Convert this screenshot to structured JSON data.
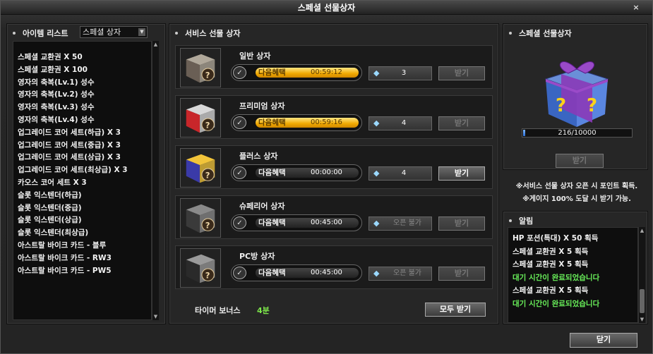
{
  "window": {
    "title": "스페셜 선물상자",
    "close_glyph": "×"
  },
  "item_list": {
    "header": "아이템 리스트",
    "dropdown_value": "스페셜 상자",
    "items": [
      "스페셜 교환권 X 50",
      "스페셜 교환권 X 100",
      "영자의 축복(Lv.1) 성수",
      "영자의 축복(Lv.2) 성수",
      "영자의 축복(Lv.3) 성수",
      "영자의 축복(Lv.4) 성수",
      "업그레이드 코어 세트(하급) X 3",
      "업그레이드 코어 세트(중급) X 3",
      "업그레이드 코어 세트(상급) X 3",
      "업그레이드 코어 세트(최상급) X 3",
      "카오스 코어 세트 X 3",
      "슬롯 익스텐더(하급)",
      "슬롯 익스텐더(중급)",
      "슬롯 익스텐더(상급)",
      "슬롯 익스텐더(최상급)",
      "아스트랄 바이크 카드 - 블루",
      "아스트랄 바이크 카드 - RW3",
      "아스트랄 바이크 카드 - PW5"
    ]
  },
  "service_boxes": {
    "header": "서비스 선물 상자",
    "boxes": [
      {
        "name": "일반 상자",
        "timer_label": "다음혜택",
        "time": "00:59:12",
        "progress": 1.0,
        "points": "3",
        "claim_label": "받기",
        "claim_enabled": false,
        "colors": [
          "#b0a89a",
          "#6a5f55"
        ]
      },
      {
        "name": "프리미엄 상자",
        "timer_label": "다음혜택",
        "time": "00:59:16",
        "progress": 1.0,
        "points": "4",
        "claim_label": "받기",
        "claim_enabled": false,
        "colors": [
          "#d8d8d8",
          "#c8262a"
        ]
      },
      {
        "name": "플러스 상자",
        "timer_label": "다음혜택",
        "time": "00:00:00",
        "progress": 0.0,
        "points": "4",
        "claim_label": "받기",
        "claim_enabled": true,
        "colors": [
          "#f2c43a",
          "#3a3aa8"
        ]
      },
      {
        "name": "슈페리어 상자",
        "timer_label": "다음혜택",
        "time": "00:45:00",
        "progress": 0.0,
        "points": "오픈 불가",
        "claim_label": "받기",
        "claim_enabled": false,
        "colors": [
          "#8a8a8a",
          "#3a3a3a"
        ]
      },
      {
        "name": "PC방 상자",
        "timer_label": "다음혜택",
        "time": "00:45:00",
        "progress": 0.0,
        "points": "오픈 불가",
        "claim_label": "받기",
        "claim_enabled": false,
        "colors": [
          "#9a9a9a",
          "#2a2a2a"
        ]
      }
    ],
    "timer_bonus_label": "타이머 보너스",
    "timer_bonus_value": "4분",
    "claim_all_label": "모두 받기"
  },
  "special_gift": {
    "header": "스페셜 선물상자",
    "gauge_text": "216/10000",
    "gauge_fraction": 0.0216,
    "claim_label": "받기",
    "notice_line1": "※서비스 선물 상자 오픈 시 포인트 획득.",
    "notice_line2": "※게이지 100% 도달 시 받기 가능."
  },
  "log": {
    "header": "알림",
    "lines": [
      {
        "text": "HP 포션(특대) X 50 획득",
        "green": false
      },
      {
        "text": "스페셜 교환권 X 5 획득",
        "green": false
      },
      {
        "text": "스페셜 교환권 X 5 획득",
        "green": false
      },
      {
        "text": "대기 시간이 완료되었습니다",
        "green": true
      },
      {
        "text": "스페셜 교환권 X 5 획득",
        "green": false
      },
      {
        "text": "대기 시간이 완료되었습니다",
        "green": true
      }
    ]
  },
  "footer": {
    "close_label": "닫기"
  }
}
